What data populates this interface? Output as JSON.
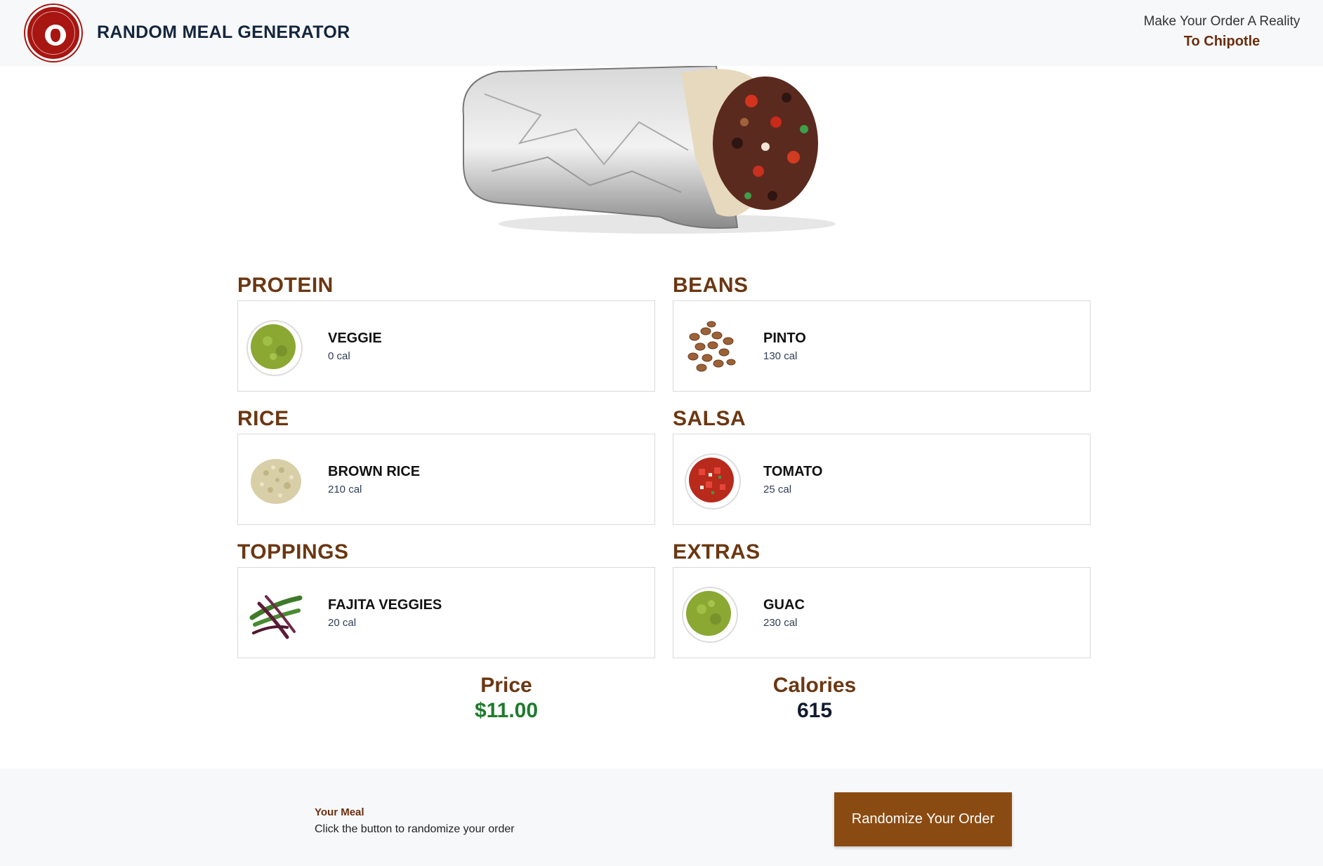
{
  "header": {
    "app_title": "RANDOM MEAL GENERATOR",
    "tagline": "Make Your Order A Reality",
    "link_label": "To Chipotle",
    "brand_color": "#a81612"
  },
  "hero": {
    "image_name": "burrito-image"
  },
  "sections": [
    {
      "title": "PROTEIN",
      "item": "VEGGIE",
      "cal": "0 cal",
      "icon": "guacamole-bowl-icon"
    },
    {
      "title": "BEANS",
      "item": "PINTO",
      "cal": "130 cal",
      "icon": "pinto-beans-icon"
    },
    {
      "title": "RICE",
      "item": "BROWN RICE",
      "cal": "210 cal",
      "icon": "brown-rice-icon"
    },
    {
      "title": "SALSA",
      "item": "TOMATO",
      "cal": "25 cal",
      "icon": "tomato-salsa-icon"
    },
    {
      "title": "TOPPINGS",
      "item": "FAJITA VEGGIES",
      "cal": "20 cal",
      "icon": "fajita-veggies-icon"
    },
    {
      "title": "EXTRAS",
      "item": "GUAC",
      "cal": "230 cal",
      "icon": "guacamole-bowl-icon"
    }
  ],
  "summary": {
    "price_label": "Price",
    "price_value": "$11.00",
    "calories_label": "Calories",
    "calories_value": "615",
    "price_color": "#1f7a2e"
  },
  "footer": {
    "heading": "Your Meal",
    "text": "Click the button to randomize your order",
    "button_label": "Randomize Your Order",
    "button_color": "#8a4b12"
  }
}
